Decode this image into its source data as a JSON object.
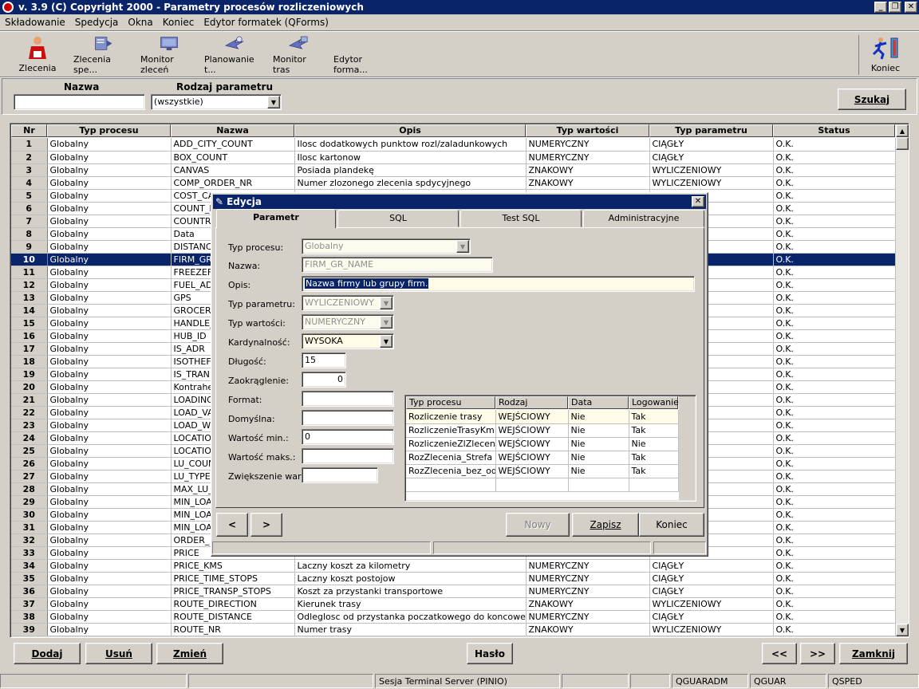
{
  "window": {
    "title": "v. 3.9    (C) Copyright 2000  -  Parametry procesów rozliczeniowych"
  },
  "menu": [
    "Składowanie",
    "Spedycja",
    "Okna",
    "Koniec",
    "Edytor formatek (QForms)"
  ],
  "toolbar": [
    {
      "label": "Zlecenia",
      "icon": "orders-person-icon"
    },
    {
      "label": "Zlecenia spe...",
      "icon": "forwarding-orders-icon"
    },
    {
      "label": "Monitor zleceń",
      "icon": "order-monitor-icon"
    },
    {
      "label": "Planowanie t...",
      "icon": "route-planning-icon"
    },
    {
      "label": "Monitor tras",
      "icon": "route-monitor-icon"
    },
    {
      "label": "Edytor forma...",
      "icon": "form-editor-icon"
    },
    {
      "label": "Koniec",
      "icon": "exit-runner-icon"
    }
  ],
  "filter": {
    "nazwa_label": "Nazwa",
    "nazwa_value": "",
    "rodzaj_label": "Rodzaj parametru",
    "rodzaj_value": "(wszystkie)",
    "search_label": "Szukaj"
  },
  "grid": {
    "headers": [
      "Nr",
      "Typ procesu",
      "Nazwa",
      "Opis",
      "Typ wartości",
      "Typ parametru",
      "Status"
    ],
    "selected_row": 10,
    "rows": [
      [
        "1",
        "Globalny",
        "ADD_CITY_COUNT",
        "Ilosc dodatkowych punktow rozl/zaladunkowych",
        "NUMERYCZNY",
        "CIĄGŁY",
        "O.K."
      ],
      [
        "2",
        "Globalny",
        "BOX_COUNT",
        "Ilosc kartonow",
        "NUMERYCZNY",
        "CIĄGŁY",
        "O.K."
      ],
      [
        "3",
        "Globalny",
        "CANVAS",
        "Posiada plandekę",
        "ZNAKOWY",
        "WYLICZENIOWY",
        "O.K."
      ],
      [
        "4",
        "Globalny",
        "COMP_ORDER_NR",
        "Numer zlozonego zlecenia spdycyjnego",
        "ZNAKOWY",
        "WYLICZENIOWY",
        "O.K."
      ],
      [
        "5",
        "Globalny",
        "COST_CA",
        "",
        "",
        "Y",
        "O.K."
      ],
      [
        "6",
        "Globalny",
        "COUNT_I",
        "",
        "",
        "",
        "O.K."
      ],
      [
        "7",
        "Globalny",
        "COUNTR",
        "",
        "",
        "",
        "O.K."
      ],
      [
        "8",
        "Globalny",
        "Data",
        "",
        "",
        "",
        "O.K."
      ],
      [
        "9",
        "Globalny",
        "DISTANC",
        "",
        "",
        "",
        "O.K."
      ],
      [
        "10",
        "Globalny",
        "FIRM_GR",
        "",
        "",
        "Y",
        "O.K."
      ],
      [
        "11",
        "Globalny",
        "FREEZEF",
        "",
        "",
        "",
        "O.K."
      ],
      [
        "12",
        "Globalny",
        "FUEL_AD",
        "",
        "",
        "",
        "O.K."
      ],
      [
        "13",
        "Globalny",
        "GPS",
        "",
        "",
        "Y",
        "O.K."
      ],
      [
        "14",
        "Globalny",
        "GROCER",
        "",
        "",
        "Y",
        "O.K."
      ],
      [
        "15",
        "Globalny",
        "HANDLE_",
        "",
        "",
        "Y",
        "O.K."
      ],
      [
        "16",
        "Globalny",
        "HUB_ID",
        "",
        "",
        "Y",
        "O.K."
      ],
      [
        "17",
        "Globalny",
        "IS_ADR",
        "",
        "",
        "Y",
        "O.K."
      ],
      [
        "18",
        "Globalny",
        "ISOTHEF",
        "",
        "",
        "Y",
        "O.K."
      ],
      [
        "19",
        "Globalny",
        "IS_TRAN",
        "",
        "",
        "Y",
        "O.K."
      ],
      [
        "20",
        "Globalny",
        "Kontraher",
        "",
        "",
        "Y",
        "O.K."
      ],
      [
        "21",
        "Globalny",
        "LOADING",
        "",
        "",
        "Y",
        "O.K."
      ],
      [
        "22",
        "Globalny",
        "LOAD_VA",
        "",
        "",
        "",
        "O.K."
      ],
      [
        "23",
        "Globalny",
        "LOAD_W",
        "",
        "",
        "",
        "O.K."
      ],
      [
        "24",
        "Globalny",
        "LOCATIO",
        "",
        "",
        "",
        "O.K."
      ],
      [
        "25",
        "Globalny",
        "LOCATIO",
        "",
        "",
        "Y",
        "O.K."
      ],
      [
        "26",
        "Globalny",
        "LU_COUN",
        "",
        "",
        "",
        "O.K."
      ],
      [
        "27",
        "Globalny",
        "LU_TYPE",
        "",
        "",
        "Y",
        "O.K."
      ],
      [
        "28",
        "Globalny",
        "MAX_LU_",
        "",
        "",
        "",
        "O.K."
      ],
      [
        "29",
        "Globalny",
        "MIN_LOA",
        "",
        "",
        "",
        "O.K."
      ],
      [
        "30",
        "Globalny",
        "MIN_LOA",
        "",
        "",
        "",
        "O.K."
      ],
      [
        "31",
        "Globalny",
        "MIN_LOA",
        "",
        "",
        "",
        "O.K."
      ],
      [
        "32",
        "Globalny",
        "ORDER_",
        "",
        "",
        "Y",
        "O.K."
      ],
      [
        "33",
        "Globalny",
        "PRICE",
        "",
        "",
        "Y",
        "O.K."
      ],
      [
        "34",
        "Globalny",
        "PRICE_KMS",
        "Laczny koszt za kilometry",
        "NUMERYCZNY",
        "CIĄGŁY",
        "O.K."
      ],
      [
        "35",
        "Globalny",
        "PRICE_TIME_STOPS",
        "Laczny koszt postojow",
        "NUMERYCZNY",
        "CIĄGŁY",
        "O.K."
      ],
      [
        "36",
        "Globalny",
        "PRICE_TRANSP_STOPS",
        "Koszt za przystanki transportowe",
        "NUMERYCZNY",
        "CIĄGŁY",
        "O.K."
      ],
      [
        "37",
        "Globalny",
        "ROUTE_DIRECTION",
        "Kierunek trasy",
        "ZNAKOWY",
        "WYLICZENIOWY",
        "O.K."
      ],
      [
        "38",
        "Globalny",
        "ROUTE_DISTANCE",
        "Odleglosc od przystanka poczatkowego do koncowego",
        "NUMERYCZNY",
        "CIĄGŁY",
        "O.K."
      ],
      [
        "39",
        "Globalny",
        "ROUTE_NR",
        "Numer trasy",
        "ZNAKOWY",
        "WYLICZENIOWY",
        "O.K."
      ]
    ]
  },
  "bottom_buttons": {
    "dodaj": "Dodaj",
    "usun": "Usuń",
    "zmien": "Zmień",
    "haslo": "Hasło",
    "prev": "<<",
    "next": ">>",
    "zamknij": "Zamknij"
  },
  "statusbar": {
    "session": "Sesja Terminal Server (PINIO)",
    "user1": "QGUARADM",
    "user2": "QGUAR",
    "user3": "QSPED"
  },
  "dialog": {
    "title": "Edycja",
    "tabs": [
      "Parametr",
      "SQL",
      "Test SQL",
      "Administracyjne"
    ],
    "labels": {
      "typ_procesu": "Typ procesu:",
      "nazwa": "Nazwa:",
      "opis": "Opis:",
      "typ_parametru": "Typ parametru:",
      "typ_wartosci": "Typ wartości:",
      "kardynalnosc": "Kardynalność:",
      "dlugosc": "Długość:",
      "zaokraglenie": "Zaokrąglenie:",
      "format": "Format:",
      "domyslna": "Domyślna:",
      "wartosc_min": "Wartość min.:",
      "wartosc_maks": "Wartość maks.:",
      "zwiekszenie": "Zwiększenie wart.:"
    },
    "values": {
      "typ_procesu": "Globalny",
      "nazwa": "FIRM_GR_NAME",
      "opis": "Nazwa firmy lub grupy firm.",
      "typ_parametru": "WYLICZENIOWY",
      "typ_wartosci": "NUMERYCZNY",
      "kardynalnosc": "WYSOKA",
      "dlugosc": "15",
      "zaokraglenie": "0",
      "format": "",
      "domyslna": "",
      "wartosc_min": "0",
      "wartosc_maks": "",
      "zwiekszenie": ""
    },
    "subgrid": {
      "headers": [
        "Typ procesu",
        "Rodzaj parametru",
        "Data cennika",
        "Logowanie"
      ],
      "rows": [
        [
          "Rozliczenie trasy",
          "WEJŚCIOWY",
          "Nie",
          "Tak"
        ],
        [
          "RozliczenieTrasyKm",
          "WEJŚCIOWY",
          "Nie",
          "Tak"
        ],
        [
          "RozliczenieZlZlecenia_",
          "WEJŚCIOWY",
          "Nie",
          "Nie"
        ],
        [
          "RozZlecenia_Strefa",
          "WEJŚCIOWY",
          "Nie",
          "Tak"
        ],
        [
          "RozZlecenia_bez_odk",
          "WEJŚCIOWY",
          "Nie",
          "Tak"
        ]
      ]
    },
    "buttons": {
      "prev": "<",
      "next": ">",
      "nowy": "Nowy",
      "zapisz": "Zapisz",
      "koniec": "Koniec"
    }
  }
}
